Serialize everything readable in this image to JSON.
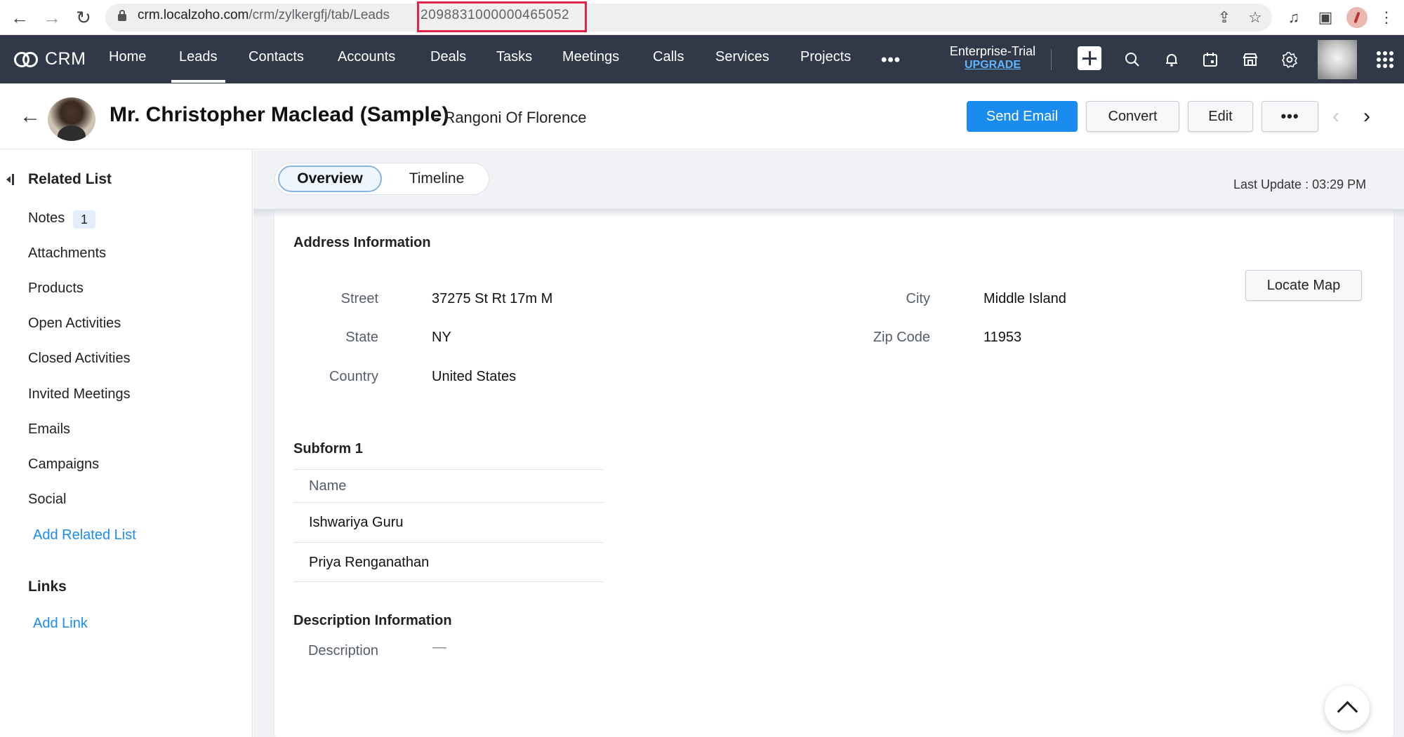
{
  "browser": {
    "url_host": "crm.localzoho.com",
    "url_path": "/crm/zylkergfj/tab/Leads",
    "url_record_id": "2098831000000465052"
  },
  "app": {
    "name": "CRM",
    "nav_items": [
      "Home",
      "Leads",
      "Contacts",
      "Accounts",
      "Deals",
      "Tasks",
      "Meetings",
      "Calls",
      "Services",
      "Projects"
    ],
    "active_nav": "Leads",
    "more_label": "•••",
    "edition": "Enterprise-Trial",
    "upgrade_label": "UPGRADE"
  },
  "record": {
    "name": "Mr. Christopher Maclead (Sample)",
    "company": "- Rangoni Of Florence",
    "buttons": {
      "send_email": "Send Email",
      "convert": "Convert",
      "edit": "Edit",
      "more": "•••"
    }
  },
  "sidebar": {
    "related_heading": "Related List",
    "items": [
      {
        "label": "Notes",
        "badge": "1"
      },
      {
        "label": "Attachments"
      },
      {
        "label": "Products"
      },
      {
        "label": "Open Activities"
      },
      {
        "label": "Closed Activities"
      },
      {
        "label": "Invited Meetings"
      },
      {
        "label": "Emails"
      },
      {
        "label": "Campaigns"
      },
      {
        "label": "Social"
      }
    ],
    "add_related": "Add Related List",
    "links_heading": "Links",
    "add_link": "Add Link"
  },
  "tabs": {
    "overview": "Overview",
    "timeline": "Timeline",
    "active": "Overview"
  },
  "last_update": "Last Update : 03:29 PM",
  "address": {
    "title": "Address Information",
    "locate_map": "Locate Map",
    "street_label": "Street",
    "street_value": "37275 St Rt 17m M",
    "city_label": "City",
    "city_value": "Middle Island",
    "state_label": "State",
    "state_value": "NY",
    "zip_label": "Zip Code",
    "zip_value": "11953",
    "country_label": "Country",
    "country_value": "United States"
  },
  "subform": {
    "title": "Subform 1",
    "column": "Name",
    "rows": [
      "Ishwariya Guru",
      "Priya Renganathan"
    ]
  },
  "description": {
    "title": "Description Information",
    "label": "Description",
    "value": "—"
  },
  "icons": {
    "browser": [
      "back-arrow-icon",
      "forward-arrow-icon",
      "reload-icon",
      "lock-icon",
      "share-icon",
      "star-icon",
      "media-list-icon",
      "sidebar-panel-icon",
      "profile-icon",
      "kebab-menu-icon"
    ],
    "app": [
      "crm-logo-icon",
      "plus-icon",
      "search-icon",
      "bell-icon",
      "calendar-icon",
      "marketplace-icon",
      "gear-icon",
      "apps-grid-icon"
    ]
  }
}
